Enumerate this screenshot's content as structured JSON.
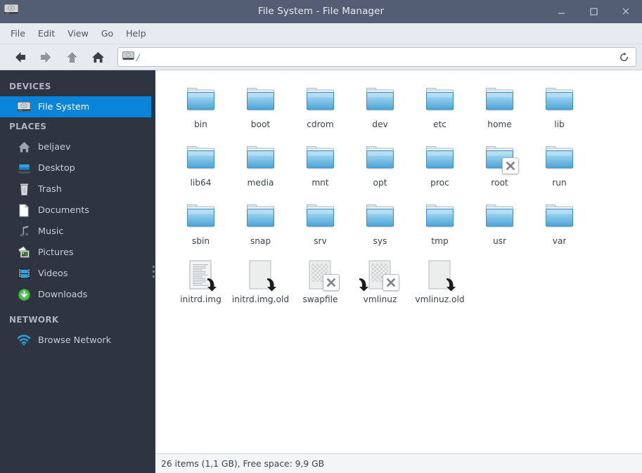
{
  "window": {
    "title": "File System - File Manager",
    "icon": "harddisk-icon",
    "controls": {
      "minimize": "minimize-icon",
      "maximize": "maximize-icon",
      "close": "close-icon"
    }
  },
  "menubar": {
    "items": [
      {
        "label": "File"
      },
      {
        "label": "Edit"
      },
      {
        "label": "View"
      },
      {
        "label": "Go"
      },
      {
        "label": "Help"
      }
    ]
  },
  "toolbar": {
    "buttons": [
      {
        "name": "back-button",
        "icon": "arrow-left-icon",
        "enabled": true
      },
      {
        "name": "forward-button",
        "icon": "arrow-right-icon",
        "enabled": false
      },
      {
        "name": "up-button",
        "icon": "arrow-up-icon",
        "enabled": false
      },
      {
        "name": "home-button",
        "icon": "home-icon",
        "enabled": true
      }
    ],
    "path": {
      "icon": "harddisk-icon",
      "value": "/",
      "placeholder": "/"
    },
    "reload": {
      "name": "reload-button",
      "icon": "reload-icon"
    }
  },
  "sidebar": {
    "groups": [
      {
        "header": "DEVICES",
        "items": [
          {
            "label": "File System",
            "icon": "harddisk-icon",
            "selected": true
          }
        ]
      },
      {
        "header": "PLACES",
        "items": [
          {
            "label": "beljaev",
            "icon": "home-icon",
            "selected": false
          },
          {
            "label": "Desktop",
            "icon": "desktop-icon",
            "selected": false
          },
          {
            "label": "Trash",
            "icon": "trash-icon",
            "selected": false
          },
          {
            "label": "Documents",
            "icon": "document-icon",
            "selected": false
          },
          {
            "label": "Music",
            "icon": "music-note-icon",
            "selected": false
          },
          {
            "label": "Pictures",
            "icon": "pictures-icon",
            "selected": false
          },
          {
            "label": "Videos",
            "icon": "video-film-icon",
            "selected": false
          },
          {
            "label": "Downloads",
            "icon": "download-arrow-icon",
            "selected": false
          }
        ]
      },
      {
        "header": "NETWORK",
        "items": [
          {
            "label": "Browse Network",
            "icon": "network-wifi-icon",
            "selected": false
          }
        ]
      }
    ]
  },
  "content": {
    "items": [
      {
        "label": "bin",
        "type": "folder",
        "emblem": "none"
      },
      {
        "label": "boot",
        "type": "folder",
        "emblem": "none"
      },
      {
        "label": "cdrom",
        "type": "folder",
        "emblem": "none"
      },
      {
        "label": "dev",
        "type": "folder",
        "emblem": "none"
      },
      {
        "label": "etc",
        "type": "folder",
        "emblem": "none"
      },
      {
        "label": "home",
        "type": "folder",
        "emblem": "none"
      },
      {
        "label": "lib",
        "type": "folder",
        "emblem": "none"
      },
      {
        "label": "lib64",
        "type": "folder",
        "emblem": "none"
      },
      {
        "label": "media",
        "type": "folder",
        "emblem": "none"
      },
      {
        "label": "mnt",
        "type": "folder",
        "emblem": "none"
      },
      {
        "label": "opt",
        "type": "folder",
        "emblem": "none"
      },
      {
        "label": "proc",
        "type": "folder",
        "emblem": "none"
      },
      {
        "label": "root",
        "type": "folder",
        "emblem": "no-access"
      },
      {
        "label": "run",
        "type": "folder",
        "emblem": "none"
      },
      {
        "label": "sbin",
        "type": "folder",
        "emblem": "none"
      },
      {
        "label": "snap",
        "type": "folder",
        "emblem": "none"
      },
      {
        "label": "srv",
        "type": "folder",
        "emblem": "none"
      },
      {
        "label": "sys",
        "type": "folder",
        "emblem": "none"
      },
      {
        "label": "tmp",
        "type": "folder",
        "emblem": "none"
      },
      {
        "label": "usr",
        "type": "folder",
        "emblem": "none"
      },
      {
        "label": "var",
        "type": "folder",
        "emblem": "none"
      },
      {
        "label": "initrd.img",
        "type": "text-file",
        "emblem": "symlink"
      },
      {
        "label": "initrd.img.old",
        "type": "blank-file",
        "emblem": "symlink"
      },
      {
        "label": "swapfile",
        "type": "unknown-file",
        "emblem": "no-access"
      },
      {
        "label": "vmlinuz",
        "type": "unknown-file",
        "emblem": "no-access-symlink"
      },
      {
        "label": "vmlinuz.old",
        "type": "blank-file",
        "emblem": "symlink"
      }
    ]
  },
  "statusbar": {
    "text": "26 items (1,1 GB), Free space: 9,9 GB"
  },
  "colors": {
    "titlebar": "#535d73",
    "sidebar": "#2f3441",
    "selection": "#0a84d8",
    "toolbar": "#e7eaee",
    "content": "#ffffff",
    "folder": "#5aacdc",
    "path_text": "#3d8fd1"
  }
}
